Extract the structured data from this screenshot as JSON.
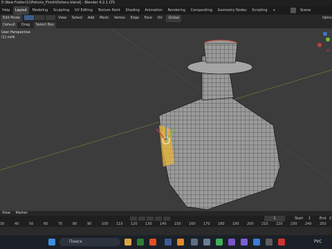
{
  "titlebar": {
    "title": "E:\\New Folder(1)\\Potions_Finish\\Potions.blend] - Blender 4.2.1 LTS"
  },
  "topmenu": {
    "items": [
      "Help",
      "Layout",
      "Modeling",
      "Sculpting",
      "UV Editing",
      "Texture Paint",
      "Shading",
      "Animation",
      "Rendering",
      "Compositing",
      "Geometry Nodes",
      "Scripting",
      "+"
    ],
    "scene": "Scene"
  },
  "header": {
    "mode": "Edit Mode",
    "menus": [
      "View",
      "Select",
      "Add",
      "Mesh",
      "Vertex",
      "Edge",
      "Face",
      "UV"
    ],
    "orientation": "Global",
    "options": "Optio"
  },
  "toolrow": {
    "orientation": "Default",
    "drag_label": "Drag",
    "select_mode": "Select Box"
  },
  "overlay": {
    "perspective": "User Perspective",
    "object": "(1) cork"
  },
  "timeline": {
    "menu": [
      "View",
      "Marker"
    ],
    "current_frame": "1",
    "start_label": "Start",
    "start_value": "1",
    "end_label": "End",
    "end_value": "2",
    "ticks": [
      "30",
      "40",
      "50",
      "60",
      "70",
      "80",
      "90",
      "100",
      "110",
      "120",
      "130",
      "140",
      "150",
      "160",
      "170",
      "180",
      "190",
      "200",
      "210",
      "220",
      "230",
      "240",
      "250"
    ]
  },
  "taskbar": {
    "search_placeholder": "Поиск",
    "lang": "РУС"
  }
}
